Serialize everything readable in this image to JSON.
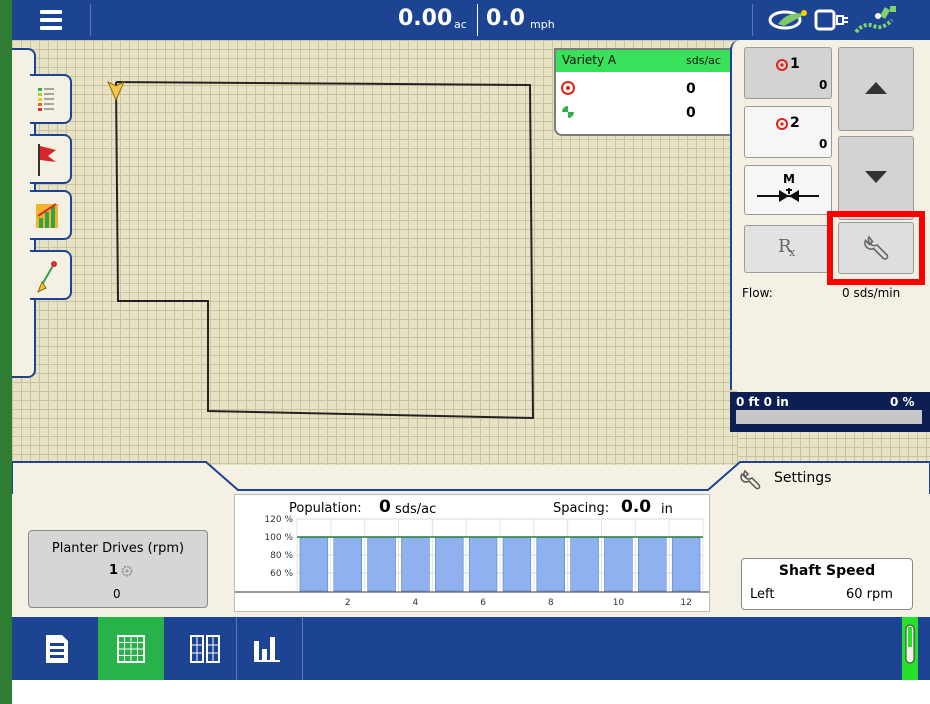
{
  "topbar": {
    "area_value": "0.00",
    "area_unit": "ac",
    "speed_value": "0.0",
    "speed_unit": "mph"
  },
  "variety": {
    "name": "Variety A",
    "unit": "sds/ac",
    "target_value": "0",
    "applied_value": "0"
  },
  "rows": {
    "row1_label": "1",
    "row1_value": "0",
    "row2_label": "2",
    "row2_value": "0",
    "manual_label": "M"
  },
  "rx_label": "R",
  "flow": {
    "label": "Flow:",
    "value": "0 sds/min"
  },
  "progress": {
    "distance": "0 ft 0 in",
    "percent": "0 %",
    "fraction": 0
  },
  "settings_label": "Settings",
  "population_chart": {
    "population_label": "Population:",
    "population_value": "0",
    "population_unit": "sds/ac",
    "spacing_label": "Spacing:",
    "spacing_value": "0.0",
    "spacing_unit": "in",
    "y_ticks": [
      "120 %",
      "100 %",
      "80 %",
      "60 %"
    ],
    "x_ticks": [
      "2",
      "4",
      "6",
      "8",
      "10",
      "12"
    ]
  },
  "chart_data": {
    "type": "bar",
    "categories": [
      "1",
      "2",
      "3",
      "4",
      "5",
      "6",
      "7",
      "8",
      "9",
      "10",
      "11",
      "12"
    ],
    "values": [
      100,
      100,
      100,
      100,
      100,
      100,
      100,
      100,
      100,
      100,
      100,
      100
    ],
    "ylim": [
      40,
      120
    ]
  },
  "planter": {
    "title": "Planter Drives (rpm)",
    "drive_number": "1",
    "value": "0"
  },
  "shaft": {
    "title": "Shaft Speed",
    "side": "Left",
    "value": "60 rpm"
  },
  "colors": {
    "topbar": "#1c4493",
    "active_green": "#27b24a",
    "bar_fill": "#8fb1f0",
    "highlight_red": "#ff0000",
    "variety_header": "#39e05a"
  },
  "icons": {
    "menu": "hamburger-menu-icon",
    "logo": "field-logo-icon",
    "display": "display-status-icon",
    "gps": "gps-satellite-icon"
  }
}
